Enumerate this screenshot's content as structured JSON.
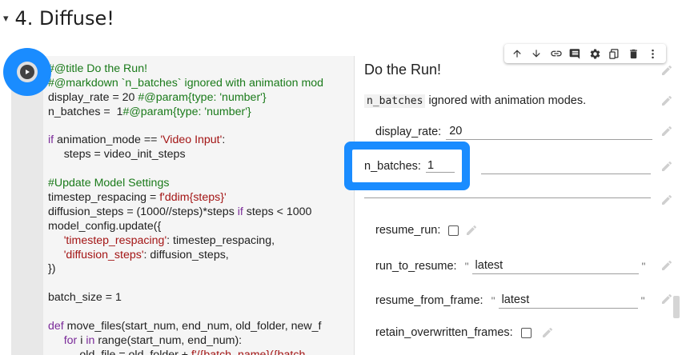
{
  "section": {
    "caret": "▾",
    "title": "4. Diffuse!"
  },
  "toolbar": {
    "items": [
      {
        "icon": "arrow-up-icon",
        "label": "Move cell up"
      },
      {
        "icon": "arrow-down-icon",
        "label": "Move cell down"
      },
      {
        "icon": "link-icon",
        "label": "Copy link to cell"
      },
      {
        "icon": "comment-icon",
        "label": "Add comment"
      },
      {
        "icon": "gear-icon",
        "label": "Cell settings"
      },
      {
        "icon": "mirror-cell-icon",
        "label": "Mirror cell in tab"
      },
      {
        "icon": "trash-icon",
        "label": "Delete cell"
      },
      {
        "icon": "more-vert-icon",
        "label": "More actions"
      }
    ]
  },
  "run_button": {
    "icon": "play-icon"
  },
  "code": {
    "lines": [
      [
        {
          "t": "#@title Do the Run!",
          "c": "comment"
        }
      ],
      [
        {
          "t": "#@markdown `n_batches` ignored with animation mod",
          "c": "comment"
        }
      ],
      [
        {
          "t": "display_rate = 20 ",
          "c": "plain"
        },
        {
          "t": "#@param{type: 'number'}",
          "c": "comment"
        }
      ],
      [
        {
          "t": "n_batches =  1",
          "c": "plain"
        },
        {
          "t": "#@param{type: 'number'}",
          "c": "comment"
        }
      ],
      [
        {
          "t": "",
          "c": "plain"
        }
      ],
      [
        {
          "t": "if",
          "c": "kw"
        },
        {
          "t": " animation_mode == ",
          "c": "plain"
        },
        {
          "t": "'Video Input'",
          "c": "str"
        },
        {
          "t": ":",
          "c": "plain"
        }
      ],
      [
        {
          "t": "     steps = video_init_steps",
          "c": "plain"
        }
      ],
      [
        {
          "t": "",
          "c": "plain"
        }
      ],
      [
        {
          "t": "#Update Model Settings",
          "c": "comment"
        }
      ],
      [
        {
          "t": "timestep_respacing = ",
          "c": "plain"
        },
        {
          "t": "f'ddim{steps}'",
          "c": "str"
        }
      ],
      [
        {
          "t": "diffusion_steps = (1000//steps)*steps ",
          "c": "plain"
        },
        {
          "t": "if",
          "c": "kw"
        },
        {
          "t": " steps < 1000",
          "c": "plain"
        }
      ],
      [
        {
          "t": "model_config.update({",
          "c": "plain"
        }
      ],
      [
        {
          "t": "     ",
          "c": "plain"
        },
        {
          "t": "'timestep_respacing'",
          "c": "str"
        },
        {
          "t": ": timestep_respacing,",
          "c": "plain"
        }
      ],
      [
        {
          "t": "     ",
          "c": "plain"
        },
        {
          "t": "'diffusion_steps'",
          "c": "str"
        },
        {
          "t": ": diffusion_steps,",
          "c": "plain"
        }
      ],
      [
        {
          "t": "})",
          "c": "plain"
        }
      ],
      [
        {
          "t": "",
          "c": "plain"
        }
      ],
      [
        {
          "t": "batch_size = 1",
          "c": "plain"
        }
      ],
      [
        {
          "t": "",
          "c": "plain"
        }
      ],
      [
        {
          "t": "def",
          "c": "kw"
        },
        {
          "t": " move_files(start_num, end_num, old_folder, new_f",
          "c": "plain"
        }
      ],
      [
        {
          "t": "     ",
          "c": "plain"
        },
        {
          "t": "for",
          "c": "kw"
        },
        {
          "t": " i ",
          "c": "plain"
        },
        {
          "t": "in",
          "c": "kw"
        },
        {
          "t": " range(start_num, end_num):",
          "c": "plain"
        }
      ],
      [
        {
          "t": "          old_file = old_folder + ",
          "c": "plain"
        },
        {
          "t": "f'/{batch_name}({batch",
          "c": "str"
        }
      ]
    ]
  },
  "form": {
    "title": "Do the Run!",
    "markdown_code": "n_batches",
    "markdown_text": " ignored with animation modes.",
    "display_rate": {
      "label": "display_rate:",
      "value": "20"
    },
    "n_batches": {
      "label": "n_batches:",
      "value": "1"
    },
    "resume_run": {
      "label": "resume_run:",
      "checked": false
    },
    "run_to_resume": {
      "label": "run_to_resume:",
      "open_quote": "\"",
      "value": "latest",
      "close_quote": "\""
    },
    "resume_from_frame": {
      "label": "resume_from_frame:",
      "open_quote": "\"",
      "value": "latest",
      "close_quote": "\""
    },
    "retain_overwritten_frames": {
      "label": "retain_overwritten_frames:",
      "checked": false
    }
  },
  "colors": {
    "accent": "#1a8cff",
    "comment": "#1a7a1a",
    "string": "#a31515",
    "keyword": "#7a2a99"
  }
}
